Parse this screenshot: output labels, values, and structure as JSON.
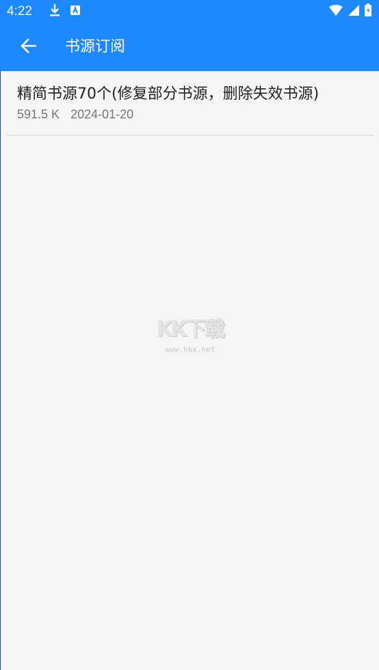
{
  "status_bar": {
    "time": "4:22",
    "left_icons": [
      "download-icon",
      "font-a-icon"
    ],
    "right_icons": [
      "wifi-icon",
      "signal-icon",
      "battery-icon"
    ]
  },
  "app_bar": {
    "title": "书源订阅",
    "back_icon": "arrow-left-icon",
    "color": "#1e88ff"
  },
  "subscriptions": [
    {
      "title": "精简书源70个(修复部分书源，删除失效书源)",
      "size": "591.5 K",
      "date": "2024-01-20"
    }
  ],
  "watermark": {
    "main": "KK下载",
    "sub": "www.kkx.net"
  }
}
